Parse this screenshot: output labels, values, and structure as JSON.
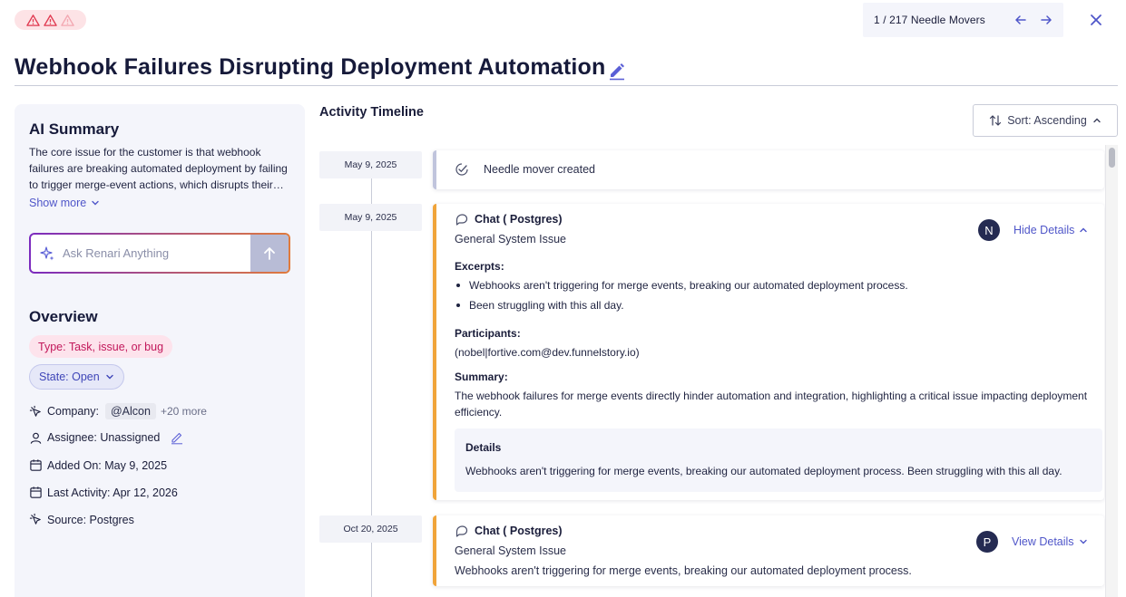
{
  "pager": {
    "text": "1 / 217 Needle Movers"
  },
  "title": "Webhook Failures Disrupting Deployment Automation",
  "ai_summary": {
    "heading": "AI Summary",
    "text": "The core issue for the customer is that webhook failures are breaking automated deployment by failing to trigger merge-event actions, which disrupts their automated deployment process.",
    "show_more": "Show more",
    "ask_placeholder": "Ask Renari Anything"
  },
  "overview": {
    "heading": "Overview",
    "type_chip": "Type: Task, issue, or bug",
    "state_chip": "State: Open",
    "company_label": "Company:",
    "company_tag": "@Alcon",
    "company_more": "+20 more",
    "assignee": "Assignee: Unassigned",
    "added_on": "Added On: May 9, 2025",
    "last_activity": "Last Activity: Apr 12, 2026",
    "source": "Source: Postgres"
  },
  "timeline": {
    "heading": "Activity Timeline",
    "sort_label": "Sort: Ascending",
    "entries": [
      {
        "date": "May 9, 2025",
        "text": "Needle mover created"
      },
      {
        "date": "May 9, 2025",
        "channel": "Chat ( Postgres)",
        "category": "General System Issue",
        "avatar": "N",
        "toggle": "Hide Details",
        "excerpts_label": "Excerpts:",
        "excerpts": [
          "Webhooks aren't triggering for merge events, breaking our automated deployment process.",
          "Been struggling with this all day."
        ],
        "participants_label": "Participants:",
        "participants": "(nobel|fortive.com@dev.funnelstory.io)",
        "summary_label": "Summary:",
        "summary": "The webhook failures for merge events directly hinder automation and integration, highlighting a critical issue impacting deployment efficiency.",
        "details_label": "Details",
        "details": "Webhooks aren't triggering for merge events, breaking our automated deployment process. Been struggling with this all day."
      },
      {
        "date": "Oct 20, 2025",
        "channel": "Chat ( Postgres)",
        "category": "General System Issue",
        "avatar": "P",
        "toggle": "View Details",
        "preview": "Webhooks aren't triggering for merge events, breaking our automated deployment process."
      }
    ]
  },
  "colors": {
    "accent": "#4f56c9",
    "card_border": "#f0a43a",
    "priority_red": "#e0384f"
  }
}
